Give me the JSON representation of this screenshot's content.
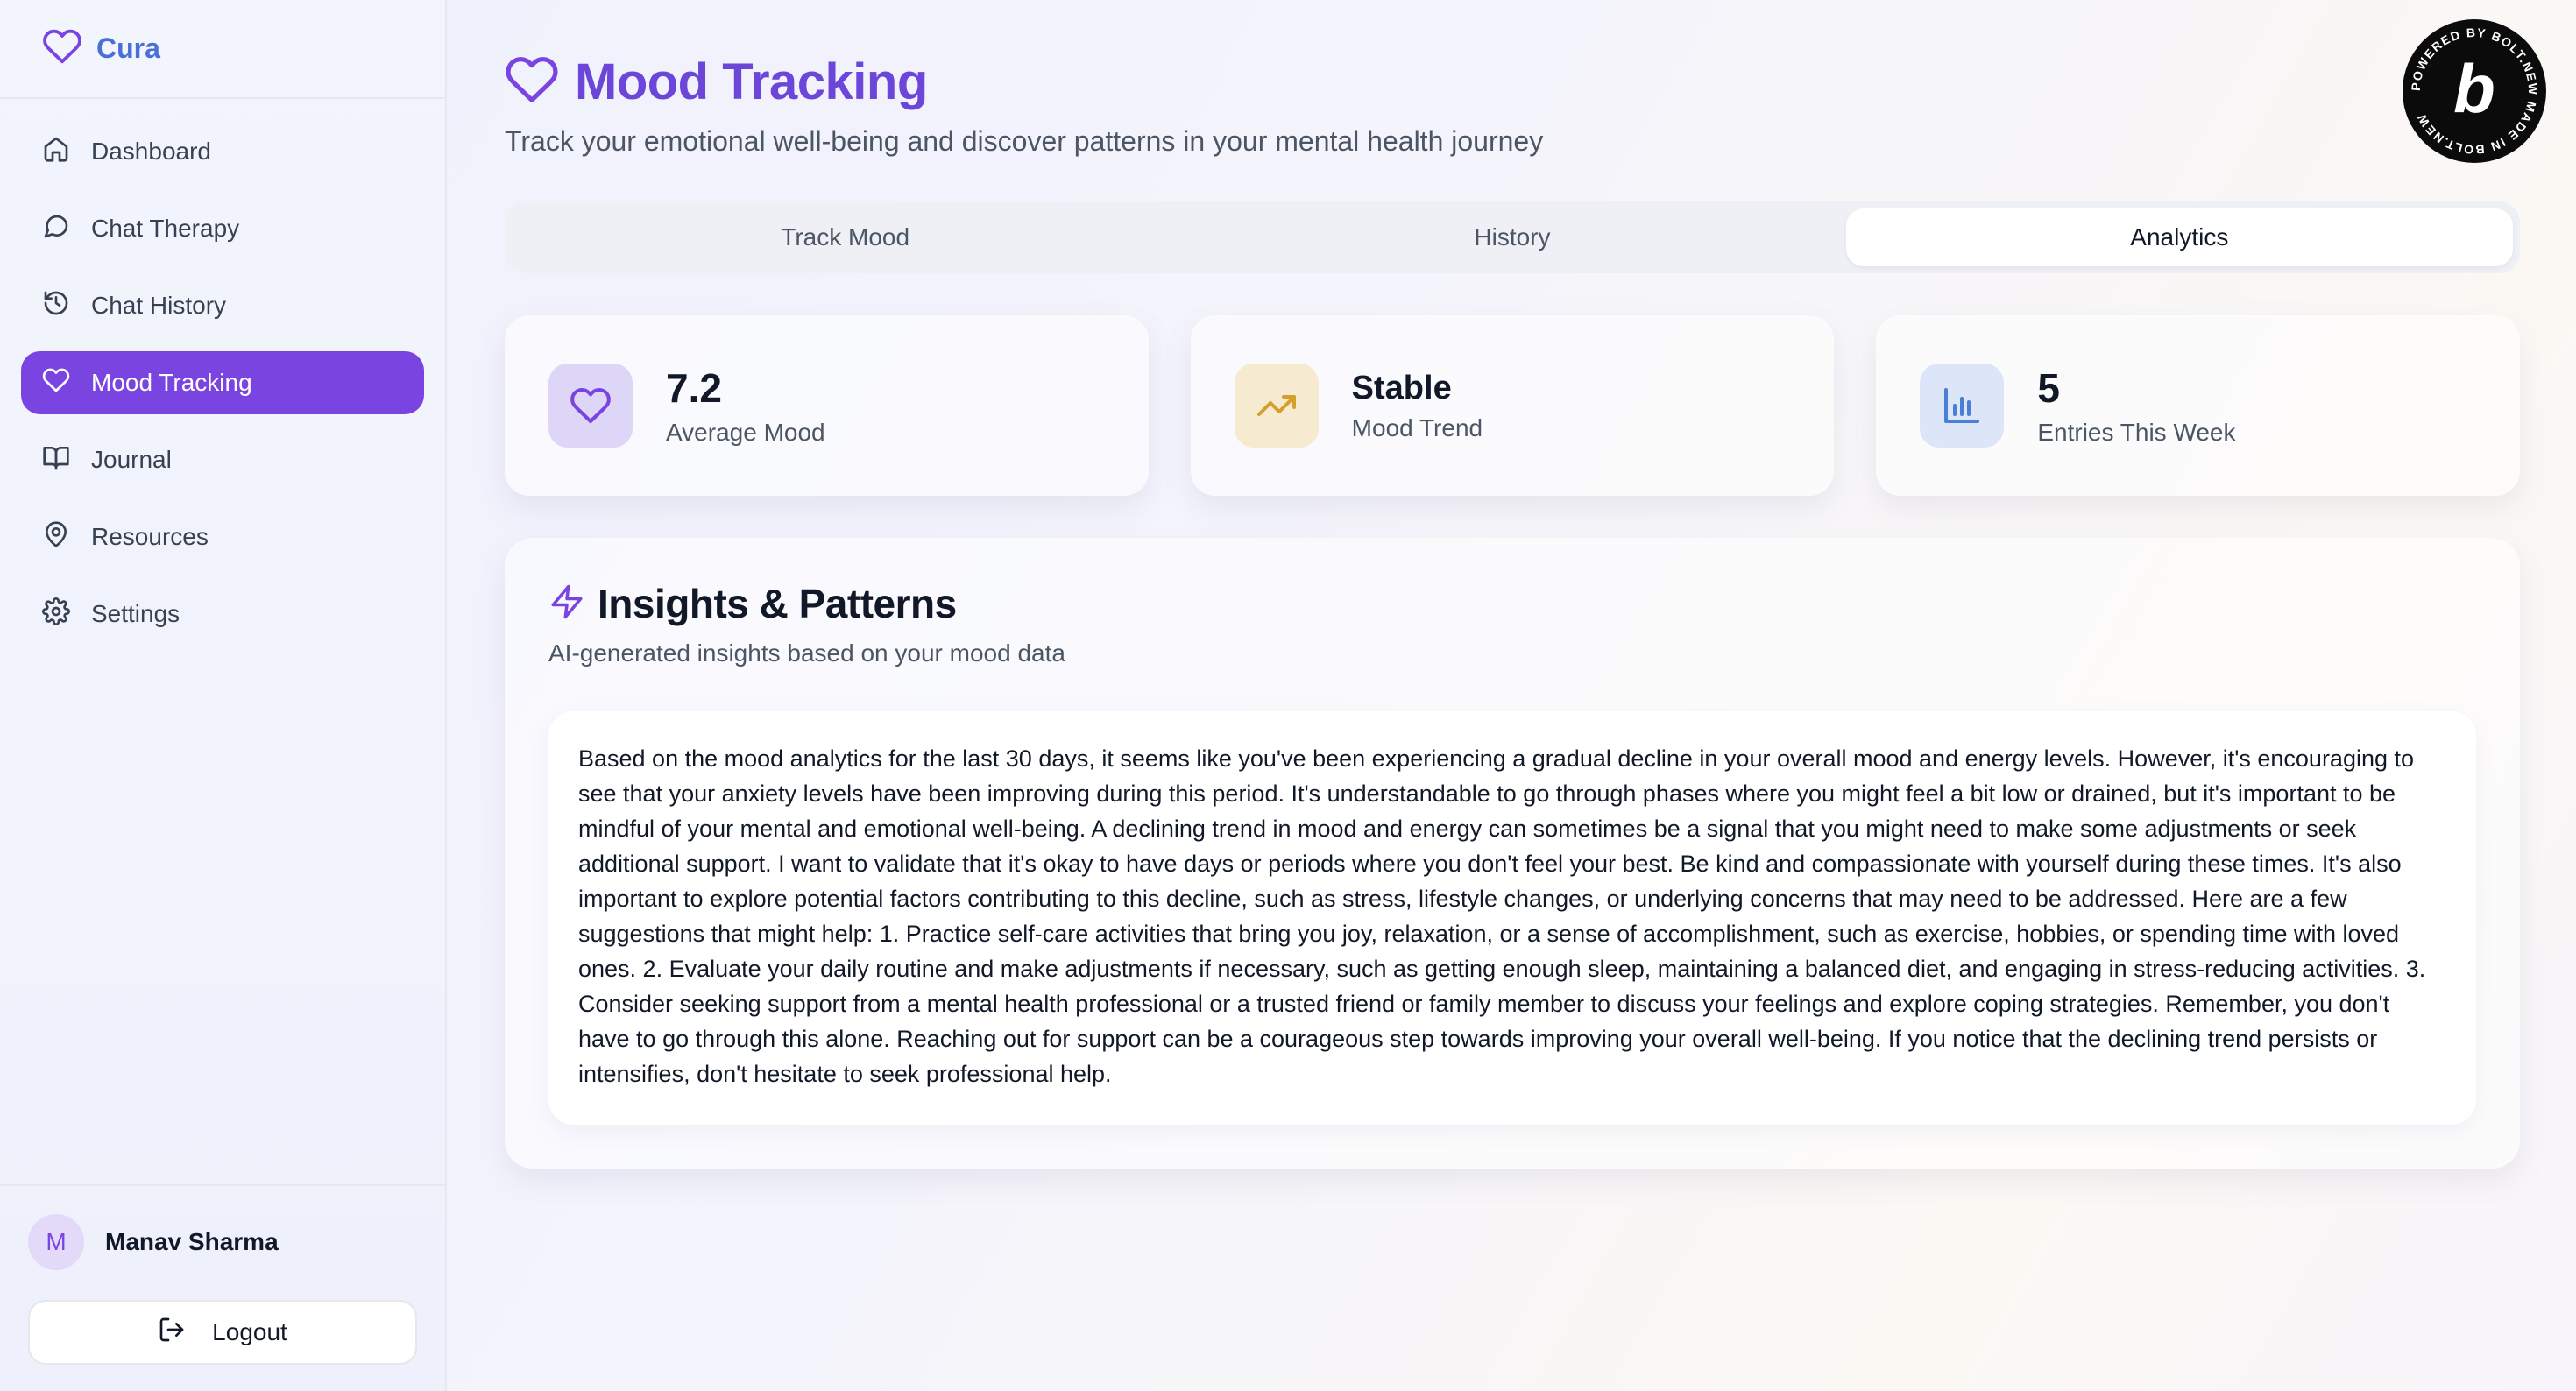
{
  "sidebar": {
    "brand": "Cura",
    "items": [
      {
        "label": "Dashboard",
        "icon": "home-icon"
      },
      {
        "label": "Chat Therapy",
        "icon": "chat-icon"
      },
      {
        "label": "Chat History",
        "icon": "history-icon"
      },
      {
        "label": "Mood Tracking",
        "icon": "heart-icon",
        "active": true
      },
      {
        "label": "Journal",
        "icon": "book-icon"
      },
      {
        "label": "Resources",
        "icon": "map-pin-icon"
      },
      {
        "label": "Settings",
        "icon": "gear-icon"
      }
    ],
    "user": {
      "initial": "M",
      "name": "Manav Sharma"
    },
    "logout_label": "Logout"
  },
  "header": {
    "title": "Mood Tracking",
    "subtitle": "Track your emotional well-being and discover patterns in your mental health journey"
  },
  "tabs": [
    {
      "label": "Track Mood"
    },
    {
      "label": "History"
    },
    {
      "label": "Analytics",
      "active": true
    }
  ],
  "stats": [
    {
      "value": "7.2",
      "label": "Average Mood",
      "icon": "heart-icon",
      "color": "#7a44e0"
    },
    {
      "value": "Stable",
      "label": "Mood Trend",
      "icon": "trending-up-icon",
      "color": "#d4a02a"
    },
    {
      "value": "5",
      "label": "Entries This Week",
      "icon": "bar-chart-icon",
      "color": "#4a7fd6"
    }
  ],
  "insights": {
    "title": "Insights & Patterns",
    "subtitle": "AI-generated insights based on your mood data",
    "text": "Based on the mood analytics for the last 30 days, it seems like you've been experiencing a gradual decline in your overall mood and energy levels. However, it's encouraging to see that your anxiety levels have been improving during this period. It's understandable to go through phases where you might feel a bit low or drained, but it's important to be mindful of your mental and emotional well-being. A declining trend in mood and energy can sometimes be a signal that you might need to make some adjustments or seek additional support. I want to validate that it's okay to have days or periods where you don't feel your best. Be kind and compassionate with yourself during these times. It's also important to explore potential factors contributing to this decline, such as stress, lifestyle changes, or underlying concerns that may need to be addressed. Here are a few suggestions that might help: 1. Practice self-care activities that bring you joy, relaxation, or a sense of accomplishment, such as exercise, hobbies, or spending time with loved ones. 2. Evaluate your daily routine and make adjustments if necessary, such as getting enough sleep, maintaining a balanced diet, and engaging in stress-reducing activities. 3. Consider seeking support from a mental health professional or a trusted friend or family member to discuss your feelings and explore coping strategies. Remember, you don't have to go through this alone. Reaching out for support can be a courageous step towards improving your overall well-being. If you notice that the declining trend persists or intensifies, don't hesitate to seek professional help."
  },
  "badge": {
    "letter": "b",
    "ring_text": "POWERED BY BOLT.NEW MADE IN BOLT.NEW"
  },
  "colors": {
    "accent": "#7a44e0",
    "brand": "#4a6fd6",
    "title": "#6b46d8"
  }
}
